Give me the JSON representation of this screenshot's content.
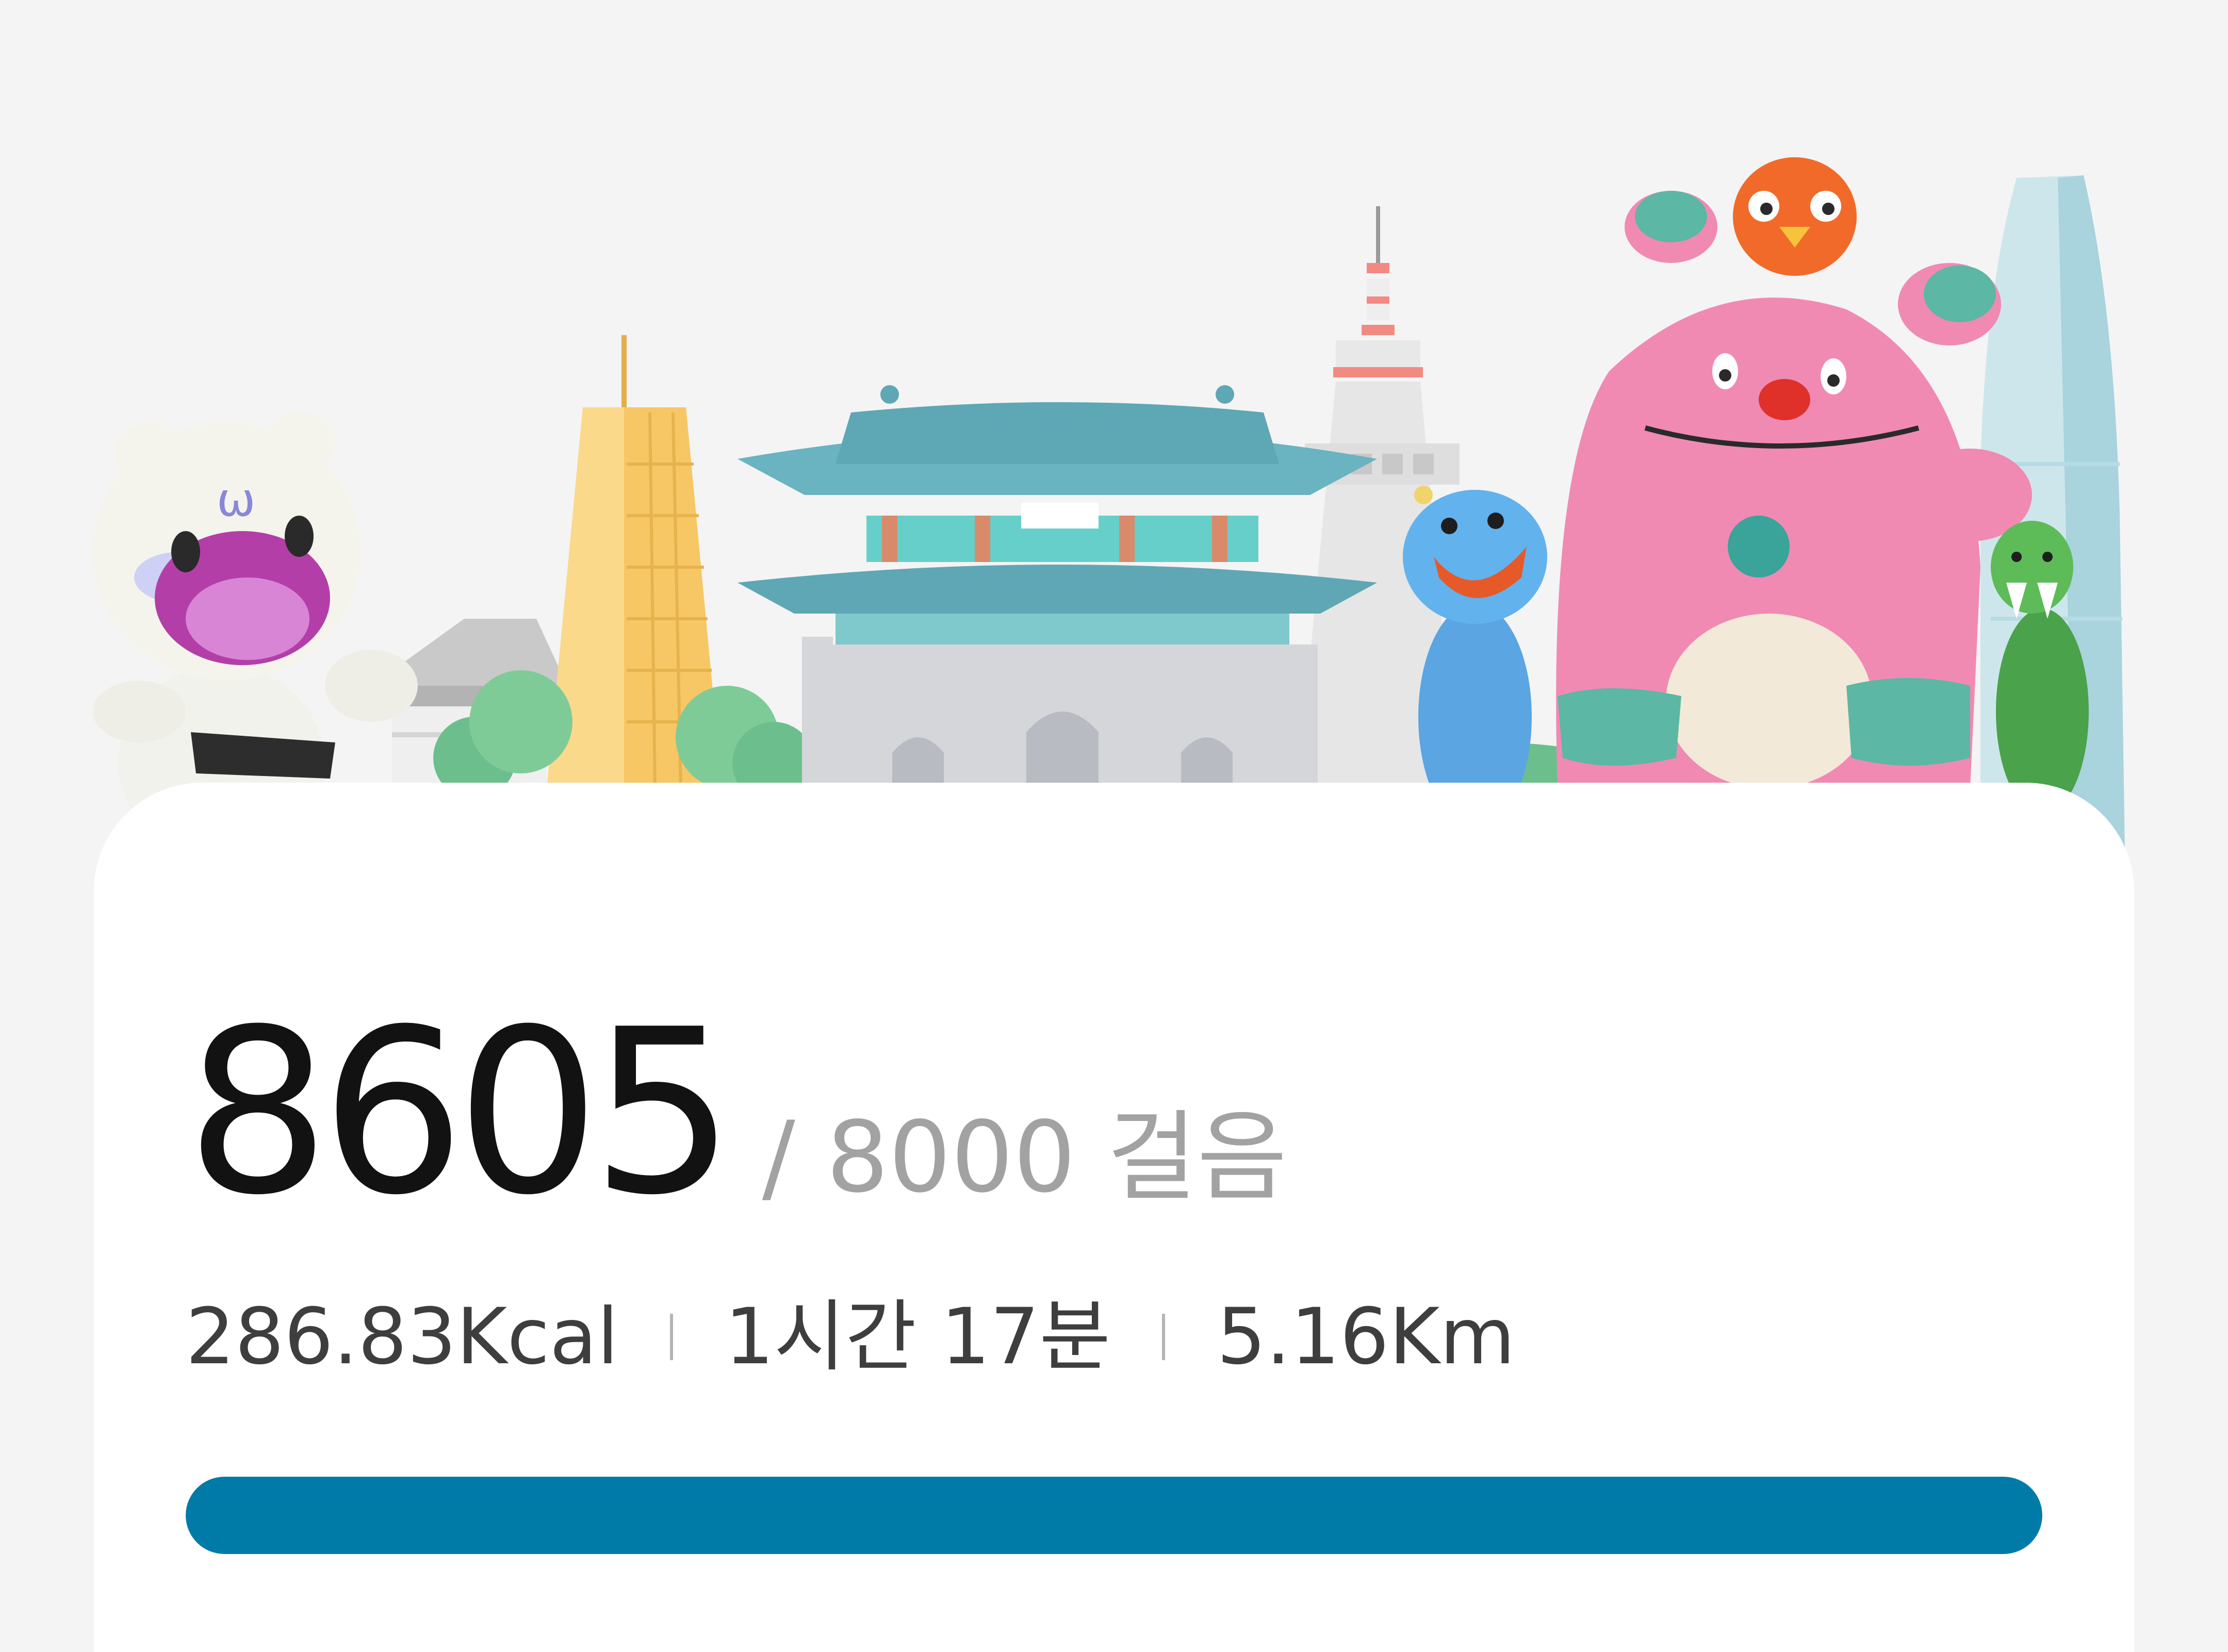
{
  "steps": {
    "count": "8605",
    "goal_text": "/ 8000 걸음"
  },
  "stats": {
    "calories": "286.83Kcal",
    "duration": "1시간 17분",
    "distance": "5.16Km"
  },
  "progress": {
    "percent": 100
  },
  "colors": {
    "background": "#f4f4f4",
    "card": "#ffffff",
    "progress": "#007ba7",
    "count_text": "#121212",
    "goal_text": "#a2a2a2"
  },
  "illustration": {
    "scene": "seoul-skyline-mascots-icon",
    "items": [
      "white-tiger-mascot-icon",
      "hanok-house-icon",
      "yellow-tower-icon",
      "green-tree-icon",
      "palace-gate-icon",
      "n-seoul-tower-icon",
      "blue-monster-mascot-icon",
      "pink-monster-mascot-icon",
      "orange-bird-mascot-icon",
      "green-dinosaur-mascot-icon",
      "skyscraper-icon"
    ]
  }
}
